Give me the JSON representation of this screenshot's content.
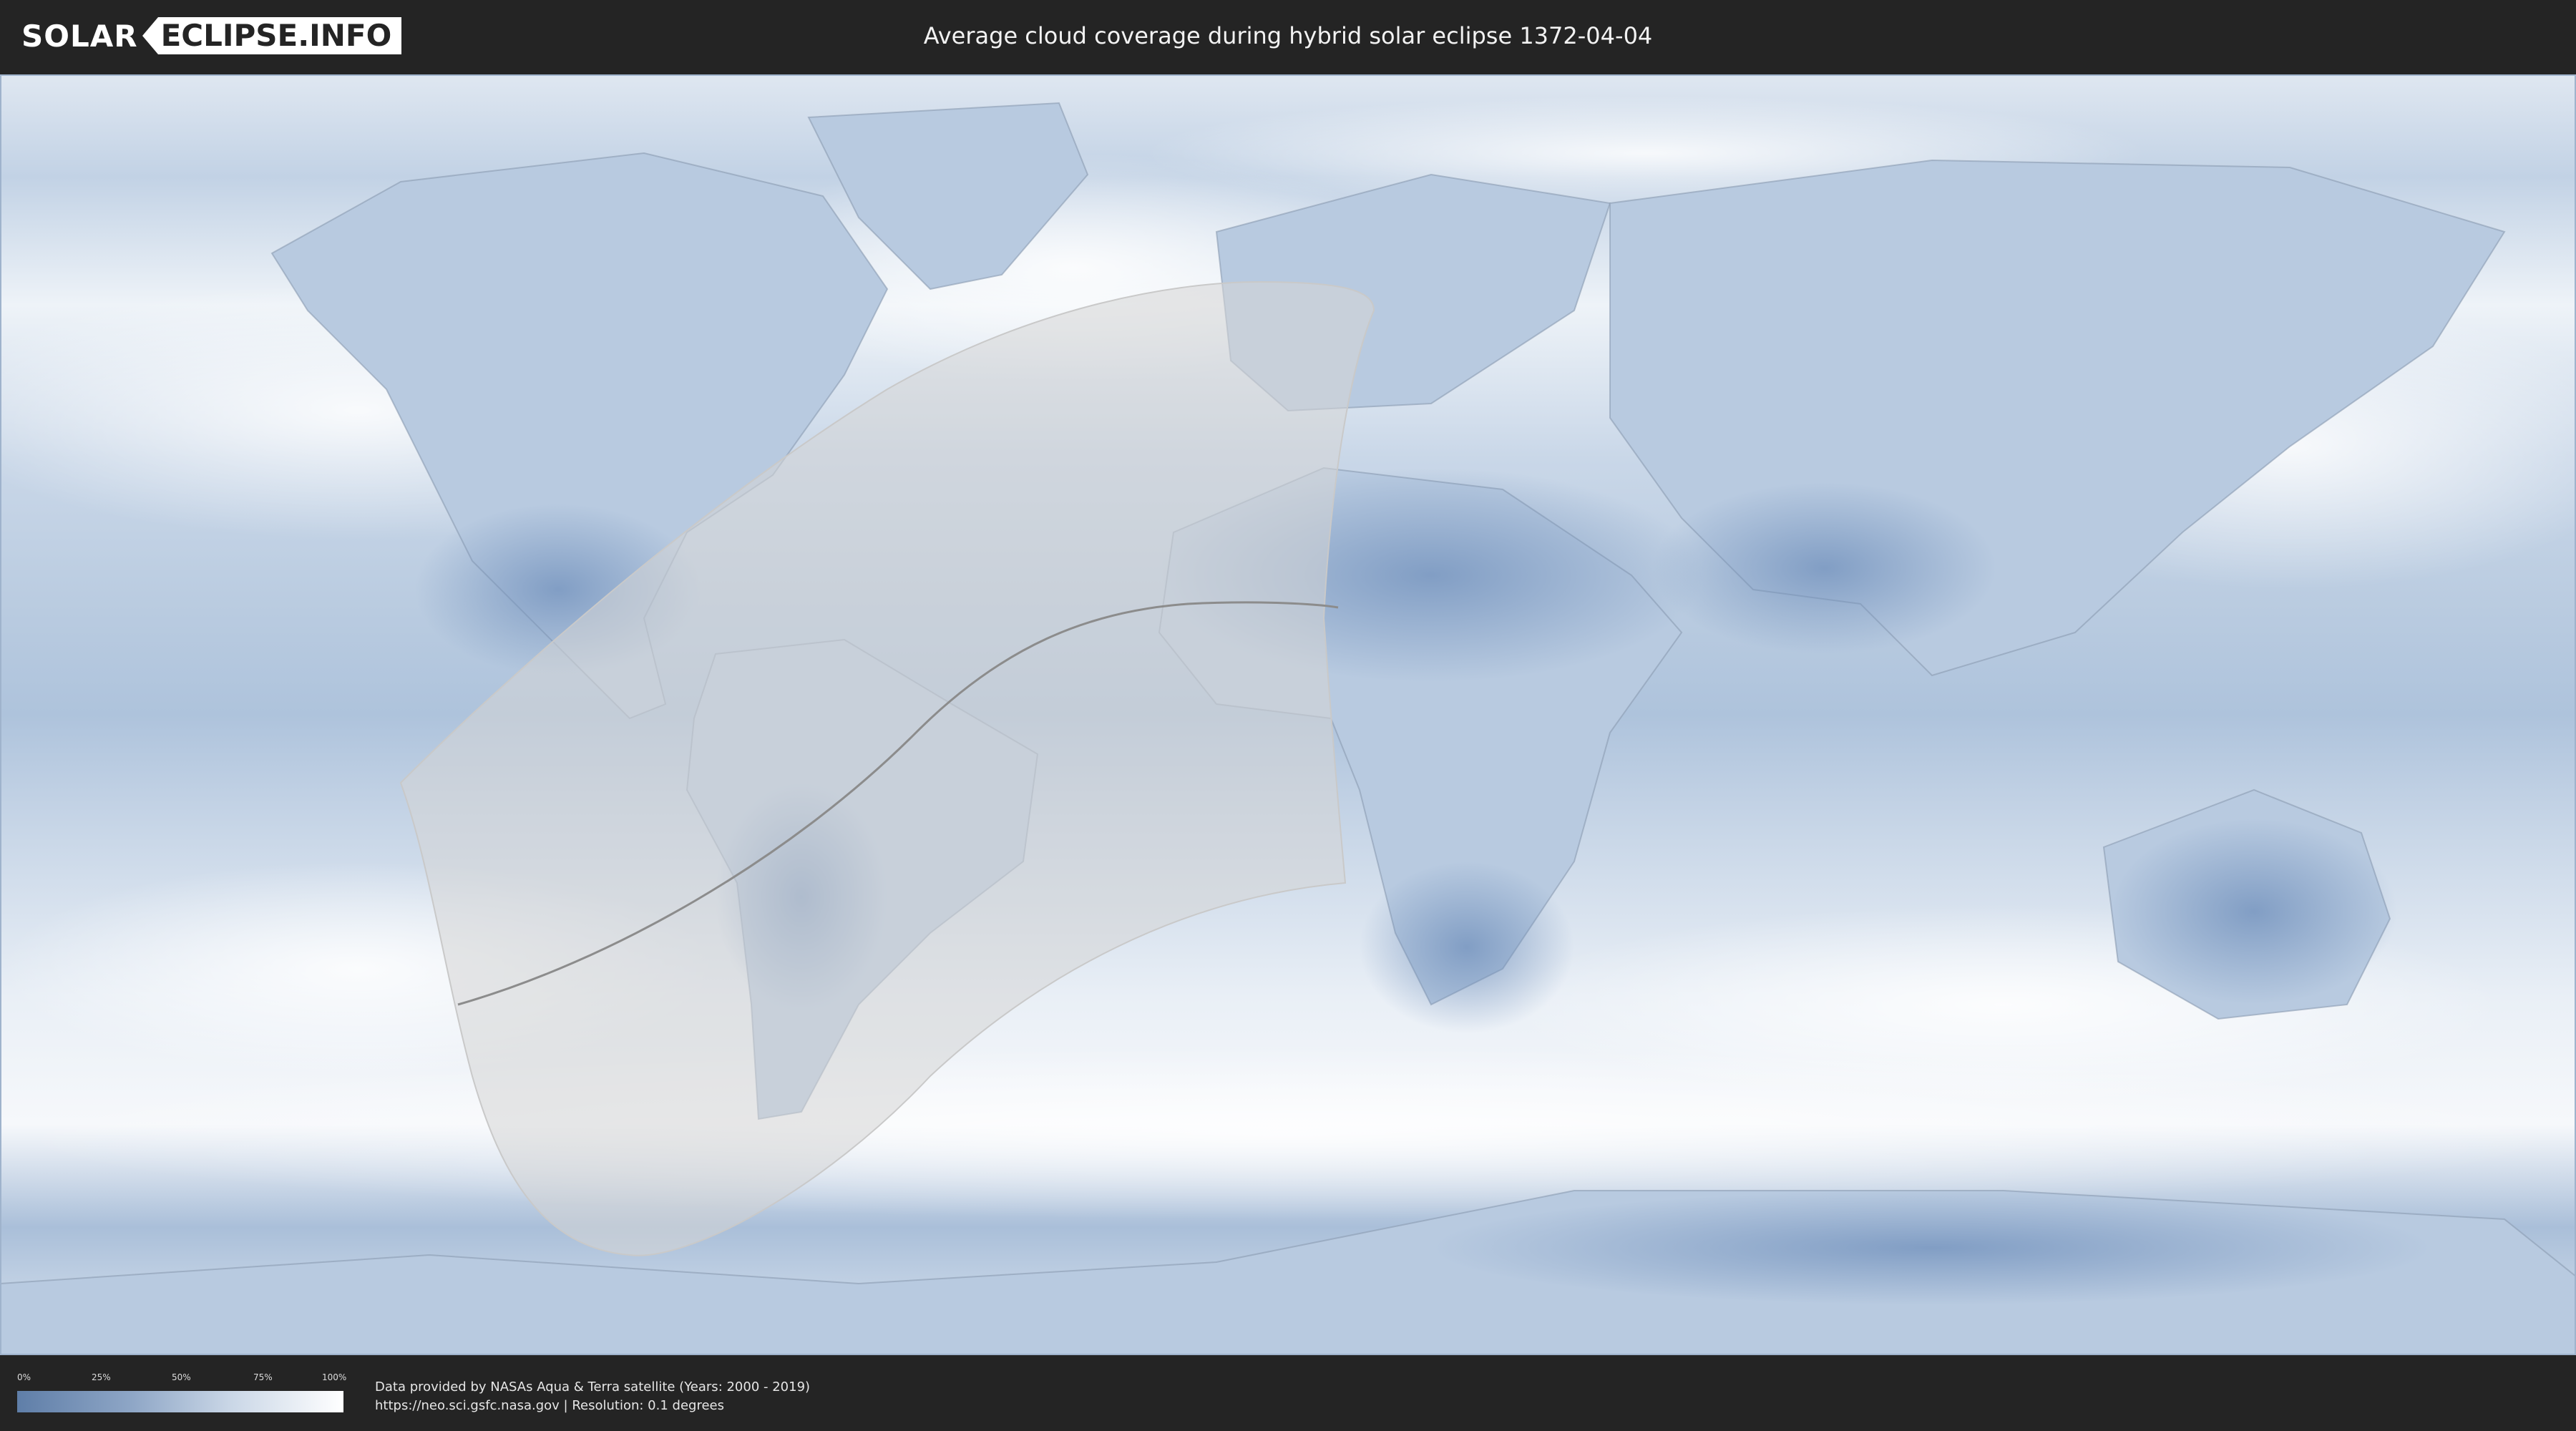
{
  "header": {
    "logo_left": "SOLAR",
    "logo_right": "ECLIPSE.INFO",
    "title": "Average cloud coverage during hybrid solar eclipse 1372-04-04"
  },
  "legend": {
    "ticks": [
      "0%",
      "25%",
      "50%",
      "75%",
      "100%"
    ],
    "colors": {
      "low": "#5f7ea8",
      "mid": "#c9d6e6",
      "high": "#ffffff"
    }
  },
  "footer": {
    "line1": "Data provided by NASAs Aqua & Terra satellite (Years: 2000 - 2019)",
    "line2": "https://neo.sci.gsfc.nasa.gov | Resolution: 0.1 degrees"
  },
  "map": {
    "base_color": "#c7d5e6",
    "cloud_color": "#f4f7fb",
    "land_clear_color": "#7f9cc4",
    "eclipse_zone_color": "#d9d9d9"
  }
}
